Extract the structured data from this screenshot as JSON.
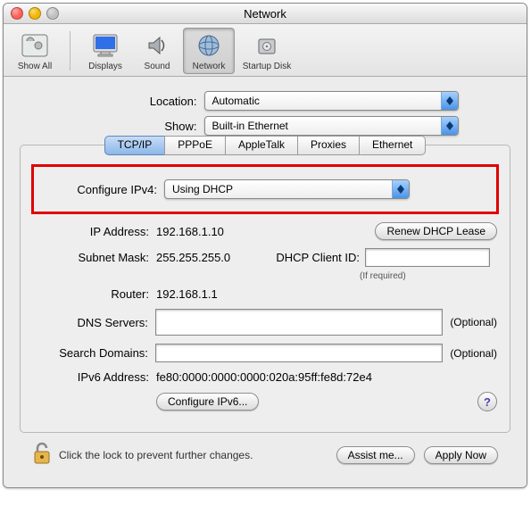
{
  "window": {
    "title": "Network"
  },
  "toolbar": {
    "show_all": "Show All",
    "displays": "Displays",
    "sound": "Sound",
    "network": "Network",
    "startup_disk": "Startup Disk"
  },
  "top": {
    "location_label": "Location:",
    "location_value": "Automatic",
    "show_label": "Show:",
    "show_value": "Built-in Ethernet"
  },
  "tabs": {
    "tcpip": "TCP/IP",
    "pppoe": "PPPoE",
    "appletalk": "AppleTalk",
    "proxies": "Proxies",
    "ethernet": "Ethernet"
  },
  "form": {
    "configure_label": "Configure IPv4:",
    "configure_value": "Using DHCP",
    "ip_label": "IP Address:",
    "ip_value": "192.168.1.10",
    "renew": "Renew DHCP Lease",
    "subnet_label": "Subnet Mask:",
    "subnet_value": "255.255.255.0",
    "dhcp_client_label": "DHCP Client ID:",
    "dhcp_client_hint": "(If required)",
    "router_label": "Router:",
    "router_value": "192.168.1.1",
    "dns_label": "DNS Servers:",
    "optional": "(Optional)",
    "search_label": "Search Domains:",
    "ipv6addr_label": "IPv6 Address:",
    "ipv6addr_value": "fe80:0000:0000:0000:020a:95ff:fe8d:72e4",
    "configure_ipv6": "Configure IPv6..."
  },
  "footer": {
    "lock_text": "Click the lock to prevent further changes.",
    "assist": "Assist me...",
    "apply": "Apply Now"
  }
}
